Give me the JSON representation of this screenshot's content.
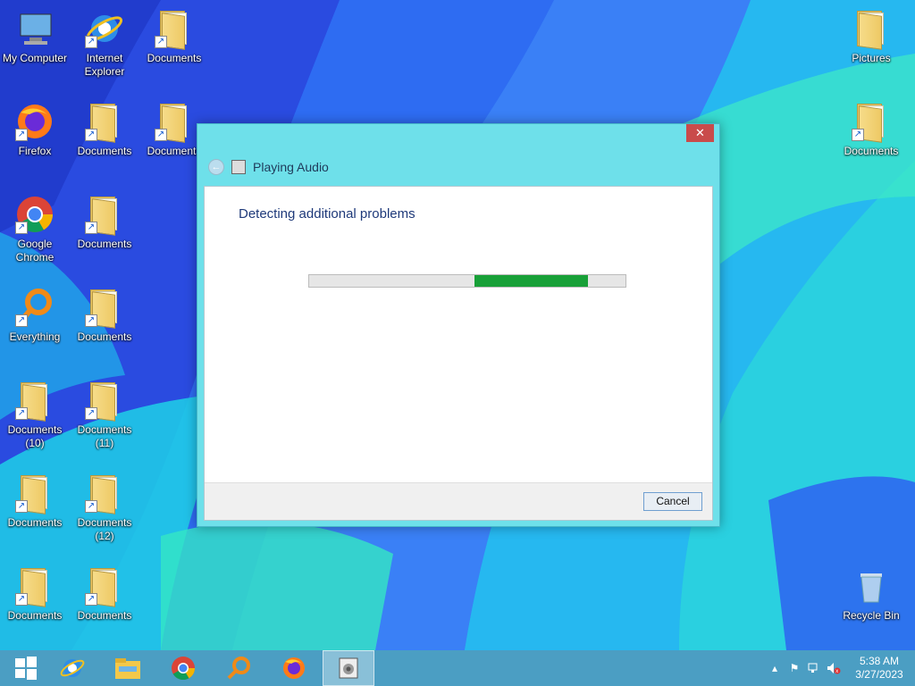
{
  "desktop": {
    "icons": [
      {
        "label": "My Computer",
        "type": "computer"
      },
      {
        "label": "Internet Explorer",
        "type": "ie"
      },
      {
        "label": "Documents",
        "type": "folder"
      },
      {
        "label": "Pictures",
        "type": "folder"
      },
      {
        "label": "Firefox",
        "type": "firefox"
      },
      {
        "label": "Documents",
        "type": "folder"
      },
      {
        "label": "Documents",
        "type": "folder"
      },
      {
        "label": "Documents",
        "type": "folder"
      },
      {
        "label": "Google Chrome",
        "type": "chrome"
      },
      {
        "label": "Documents",
        "type": "folder"
      },
      {
        "label": "Everything",
        "type": "everything"
      },
      {
        "label": "Documents",
        "type": "folder"
      },
      {
        "label": "Documents (10)",
        "type": "folder"
      },
      {
        "label": "Documents (11)",
        "type": "folder"
      },
      {
        "label": "Documents",
        "type": "folder"
      },
      {
        "label": "Documents (12)",
        "type": "folder"
      },
      {
        "label": "Documents",
        "type": "folder"
      },
      {
        "label": "Documents",
        "type": "folder"
      },
      {
        "label": "Recycle Bin",
        "type": "recycle"
      }
    ]
  },
  "dialog": {
    "close_label": "✕",
    "title": "Playing Audio",
    "heading": "Detecting additional problems",
    "progress_indeterminate": true,
    "cancel_label": "Cancel"
  },
  "taskbar": {
    "apps": [
      {
        "name": "start-button",
        "icon": "windows-logo-icon"
      },
      {
        "name": "ie",
        "icon": "internet-explorer-icon"
      },
      {
        "name": "explorer",
        "icon": "file-explorer-icon"
      },
      {
        "name": "chrome",
        "icon": "chrome-icon"
      },
      {
        "name": "everything",
        "icon": "everything-search-icon"
      },
      {
        "name": "firefox",
        "icon": "firefox-icon"
      },
      {
        "name": "troubleshooter",
        "icon": "troubleshooter-icon"
      }
    ],
    "time": "5:38 AM",
    "date": "3/27/2023"
  },
  "colors": {
    "accent_title": "#1f3a7a",
    "progress_fill": "#18a038",
    "close_red": "#c94b4b",
    "dialog_frame": "#6ee0ea"
  }
}
